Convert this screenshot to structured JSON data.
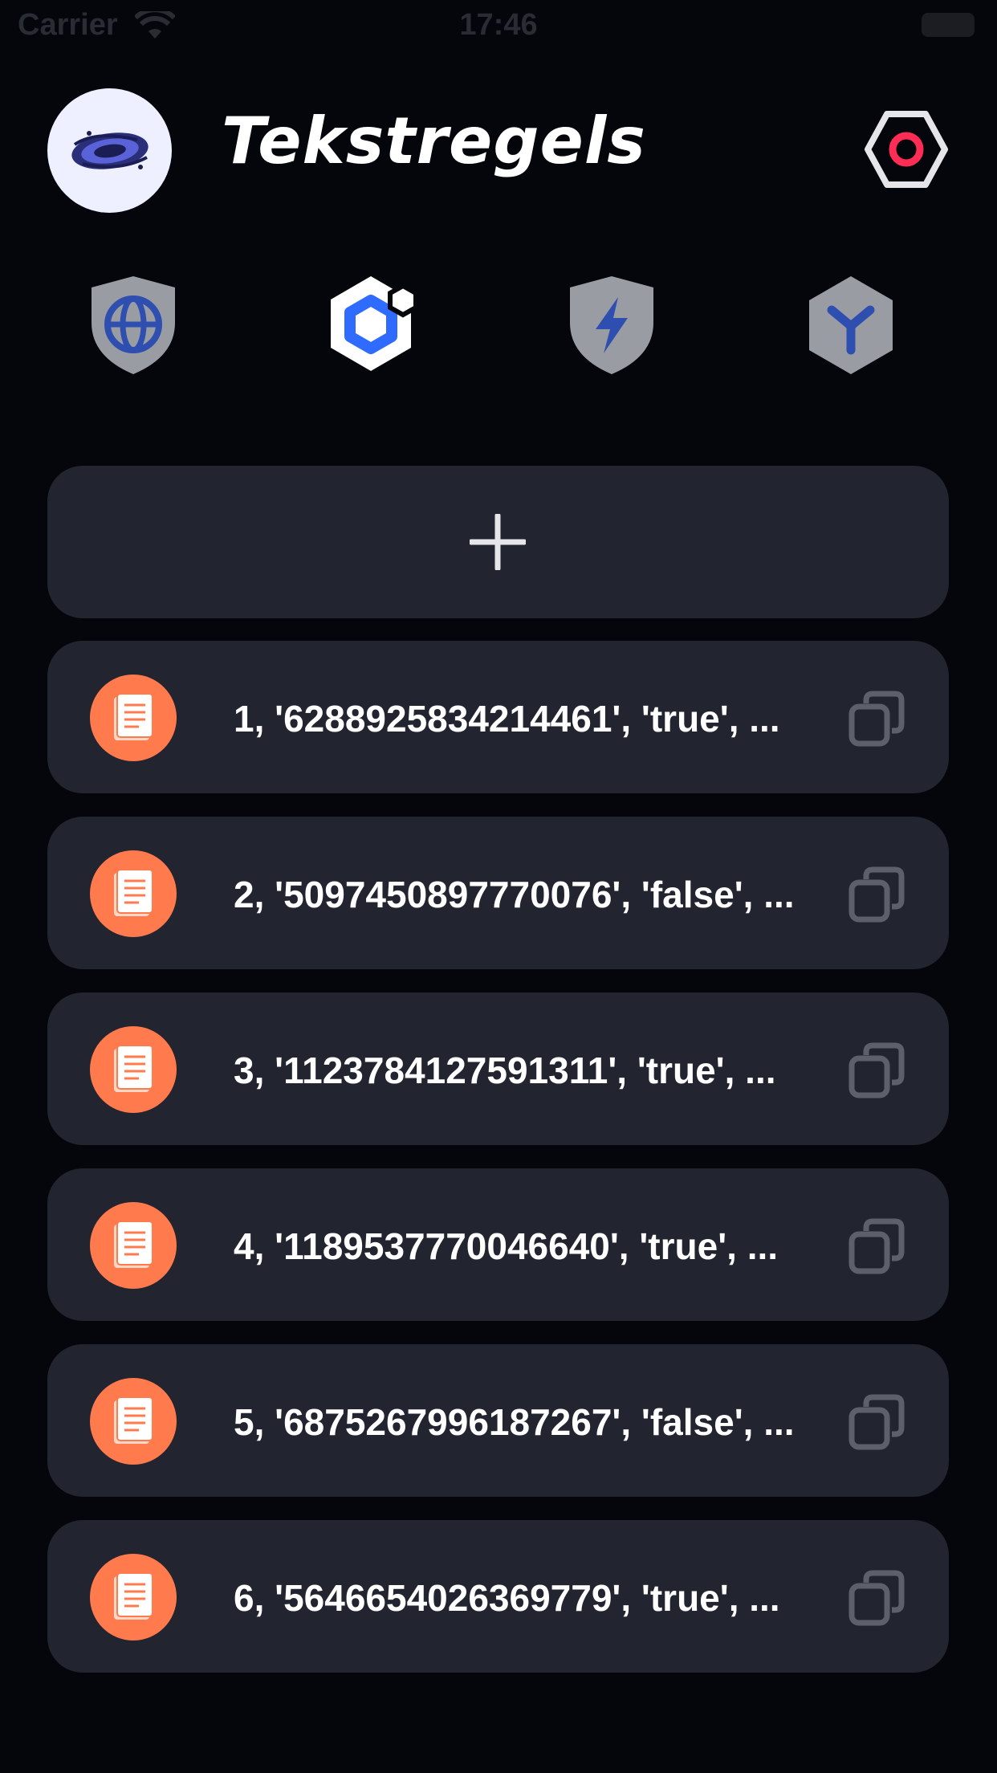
{
  "status_bar": {
    "carrier": "Carrier",
    "time": "17:46"
  },
  "header": {
    "title": "Tekstregels",
    "settings_icon": "hexagon-record-icon"
  },
  "protocols": [
    {
      "icon": "shield-globe-icon",
      "color": "#9a9ca3"
    },
    {
      "icon": "hexagon-cube-icon",
      "color": "#ffffff",
      "accent": "#2f6bff"
    },
    {
      "icon": "shield-bolt-icon",
      "color": "#9a9ca3"
    },
    {
      "icon": "hexagon-y-icon",
      "color": "#9a9ca3"
    }
  ],
  "add_button": {
    "icon": "plus-icon"
  },
  "rows": [
    {
      "text": "1, '6288925834214461', 'true', ..."
    },
    {
      "text": "2, '5097450897770076', 'false', ..."
    },
    {
      "text": "3, '1123784127591311', 'true', ..."
    },
    {
      "text": "4, '1189537770046640', 'true', ..."
    },
    {
      "text": "5, '6875267996187267', 'false', ..."
    },
    {
      "text": "6, '5646654026369779', 'true', ..."
    }
  ],
  "colors": {
    "background": "#05060b",
    "card": "#22242f",
    "row_icon": "#ff7a4d",
    "accent_red": "#ff2d55",
    "accent_blue": "#2f4fb0"
  }
}
